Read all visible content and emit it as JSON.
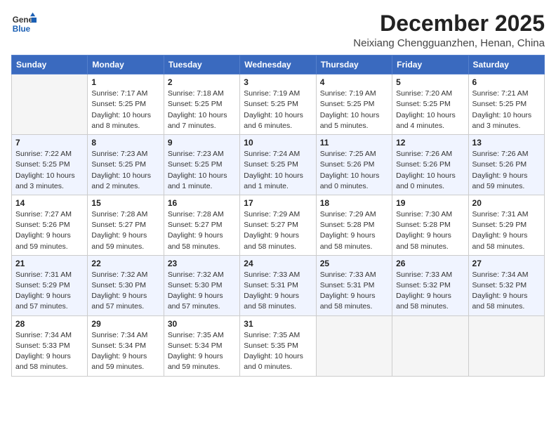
{
  "header": {
    "logo_line1": "General",
    "logo_line2": "Blue",
    "month": "December 2025",
    "location": "Neixiang Chengguanzhen, Henan, China"
  },
  "weekdays": [
    "Sunday",
    "Monday",
    "Tuesday",
    "Wednesday",
    "Thursday",
    "Friday",
    "Saturday"
  ],
  "weeks": [
    [
      {
        "day": "",
        "info": ""
      },
      {
        "day": "1",
        "info": "Sunrise: 7:17 AM\nSunset: 5:25 PM\nDaylight: 10 hours\nand 8 minutes."
      },
      {
        "day": "2",
        "info": "Sunrise: 7:18 AM\nSunset: 5:25 PM\nDaylight: 10 hours\nand 7 minutes."
      },
      {
        "day": "3",
        "info": "Sunrise: 7:19 AM\nSunset: 5:25 PM\nDaylight: 10 hours\nand 6 minutes."
      },
      {
        "day": "4",
        "info": "Sunrise: 7:19 AM\nSunset: 5:25 PM\nDaylight: 10 hours\nand 5 minutes."
      },
      {
        "day": "5",
        "info": "Sunrise: 7:20 AM\nSunset: 5:25 PM\nDaylight: 10 hours\nand 4 minutes."
      },
      {
        "day": "6",
        "info": "Sunrise: 7:21 AM\nSunset: 5:25 PM\nDaylight: 10 hours\nand 3 minutes."
      }
    ],
    [
      {
        "day": "7",
        "info": "Sunrise: 7:22 AM\nSunset: 5:25 PM\nDaylight: 10 hours\nand 3 minutes."
      },
      {
        "day": "8",
        "info": "Sunrise: 7:23 AM\nSunset: 5:25 PM\nDaylight: 10 hours\nand 2 minutes."
      },
      {
        "day": "9",
        "info": "Sunrise: 7:23 AM\nSunset: 5:25 PM\nDaylight: 10 hours\nand 1 minute."
      },
      {
        "day": "10",
        "info": "Sunrise: 7:24 AM\nSunset: 5:25 PM\nDaylight: 10 hours\nand 1 minute."
      },
      {
        "day": "11",
        "info": "Sunrise: 7:25 AM\nSunset: 5:26 PM\nDaylight: 10 hours\nand 0 minutes."
      },
      {
        "day": "12",
        "info": "Sunrise: 7:26 AM\nSunset: 5:26 PM\nDaylight: 10 hours\nand 0 minutes."
      },
      {
        "day": "13",
        "info": "Sunrise: 7:26 AM\nSunset: 5:26 PM\nDaylight: 9 hours\nand 59 minutes."
      }
    ],
    [
      {
        "day": "14",
        "info": "Sunrise: 7:27 AM\nSunset: 5:26 PM\nDaylight: 9 hours\nand 59 minutes."
      },
      {
        "day": "15",
        "info": "Sunrise: 7:28 AM\nSunset: 5:27 PM\nDaylight: 9 hours\nand 59 minutes."
      },
      {
        "day": "16",
        "info": "Sunrise: 7:28 AM\nSunset: 5:27 PM\nDaylight: 9 hours\nand 58 minutes."
      },
      {
        "day": "17",
        "info": "Sunrise: 7:29 AM\nSunset: 5:27 PM\nDaylight: 9 hours\nand 58 minutes."
      },
      {
        "day": "18",
        "info": "Sunrise: 7:29 AM\nSunset: 5:28 PM\nDaylight: 9 hours\nand 58 minutes."
      },
      {
        "day": "19",
        "info": "Sunrise: 7:30 AM\nSunset: 5:28 PM\nDaylight: 9 hours\nand 58 minutes."
      },
      {
        "day": "20",
        "info": "Sunrise: 7:31 AM\nSunset: 5:29 PM\nDaylight: 9 hours\nand 58 minutes."
      }
    ],
    [
      {
        "day": "21",
        "info": "Sunrise: 7:31 AM\nSunset: 5:29 PM\nDaylight: 9 hours\nand 57 minutes."
      },
      {
        "day": "22",
        "info": "Sunrise: 7:32 AM\nSunset: 5:30 PM\nDaylight: 9 hours\nand 57 minutes."
      },
      {
        "day": "23",
        "info": "Sunrise: 7:32 AM\nSunset: 5:30 PM\nDaylight: 9 hours\nand 57 minutes."
      },
      {
        "day": "24",
        "info": "Sunrise: 7:33 AM\nSunset: 5:31 PM\nDaylight: 9 hours\nand 58 minutes."
      },
      {
        "day": "25",
        "info": "Sunrise: 7:33 AM\nSunset: 5:31 PM\nDaylight: 9 hours\nand 58 minutes."
      },
      {
        "day": "26",
        "info": "Sunrise: 7:33 AM\nSunset: 5:32 PM\nDaylight: 9 hours\nand 58 minutes."
      },
      {
        "day": "27",
        "info": "Sunrise: 7:34 AM\nSunset: 5:32 PM\nDaylight: 9 hours\nand 58 minutes."
      }
    ],
    [
      {
        "day": "28",
        "info": "Sunrise: 7:34 AM\nSunset: 5:33 PM\nDaylight: 9 hours\nand 58 minutes."
      },
      {
        "day": "29",
        "info": "Sunrise: 7:34 AM\nSunset: 5:34 PM\nDaylight: 9 hours\nand 59 minutes."
      },
      {
        "day": "30",
        "info": "Sunrise: 7:35 AM\nSunset: 5:34 PM\nDaylight: 9 hours\nand 59 minutes."
      },
      {
        "day": "31",
        "info": "Sunrise: 7:35 AM\nSunset: 5:35 PM\nDaylight: 10 hours\nand 0 minutes."
      },
      {
        "day": "",
        "info": ""
      },
      {
        "day": "",
        "info": ""
      },
      {
        "day": "",
        "info": ""
      }
    ]
  ]
}
